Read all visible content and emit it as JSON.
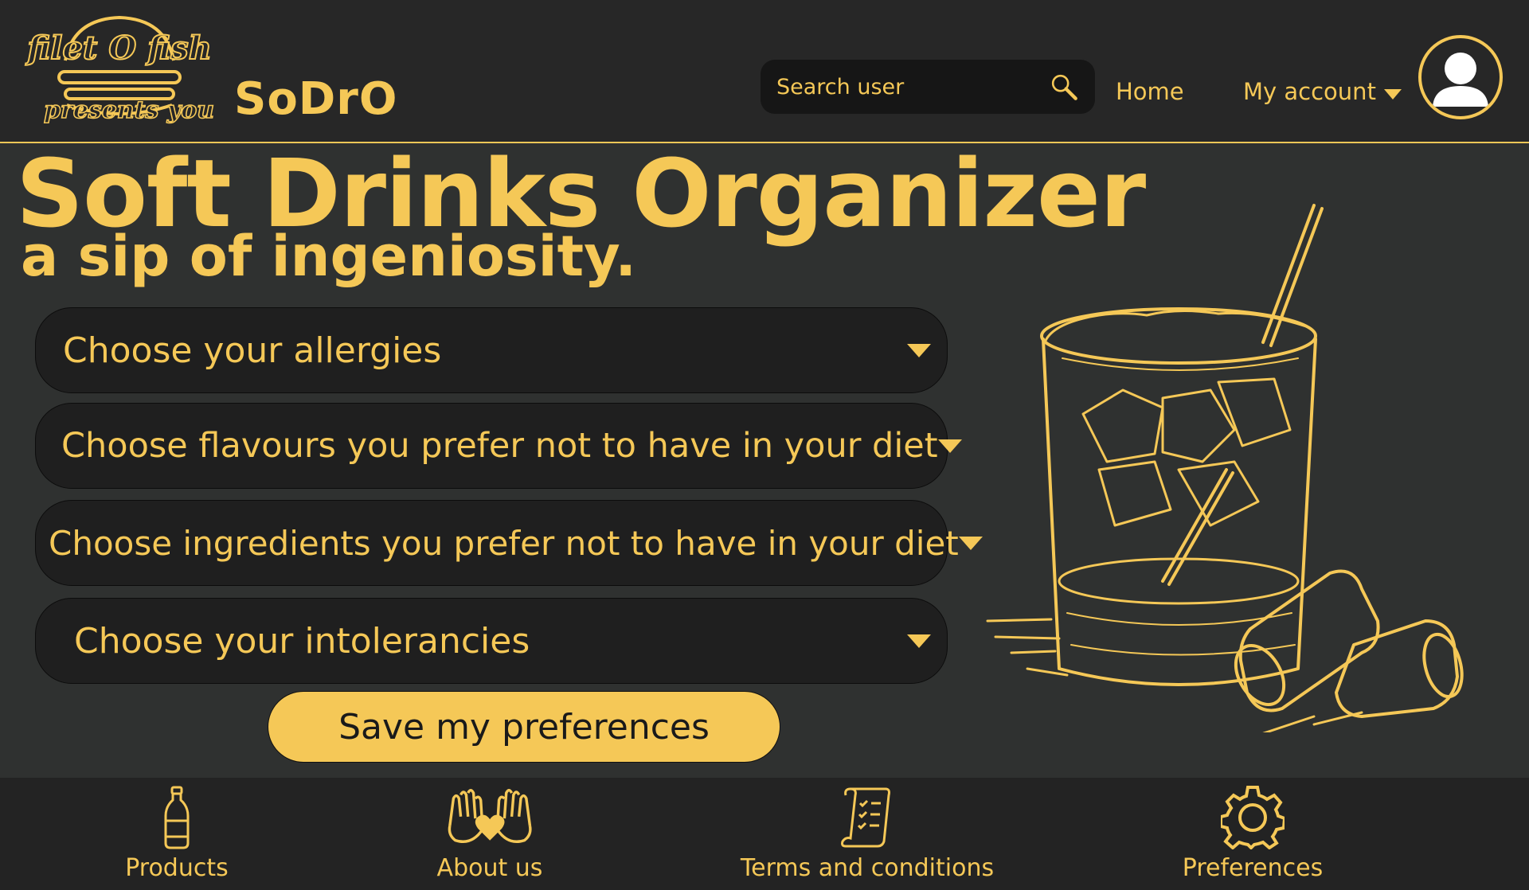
{
  "header": {
    "logo_text_top": "filet O fish",
    "logo_text_bottom": "presents you",
    "brand": "SoDrO",
    "search": {
      "placeholder": "Search user"
    },
    "nav": {
      "home": "Home",
      "account": "My account"
    }
  },
  "hero": {
    "title": "Soft Drinks Organizer",
    "subtitle": "a sip of ingeniosity."
  },
  "preferences": {
    "dropdowns": [
      {
        "label": "Choose your allergies"
      },
      {
        "label": "Choose flavours you prefer not to have in your diet"
      },
      {
        "label": "Choose ingredients you prefer not to have in your diet"
      },
      {
        "label": "Choose your intolerancies"
      }
    ],
    "save_label": "Save my preferences"
  },
  "footer": {
    "items": [
      {
        "label": "Products",
        "icon": "bottle-icon"
      },
      {
        "label": "About us",
        "icon": "heart-hands-icon"
      },
      {
        "label": "Terms and conditions",
        "icon": "scroll-checklist-icon"
      },
      {
        "label": "Preferences",
        "icon": "gear-icon"
      }
    ]
  },
  "colors": {
    "accent": "#f5c857",
    "background": "#2f3130",
    "header_bg": "#272727",
    "field_bg": "#1f1f1f"
  }
}
